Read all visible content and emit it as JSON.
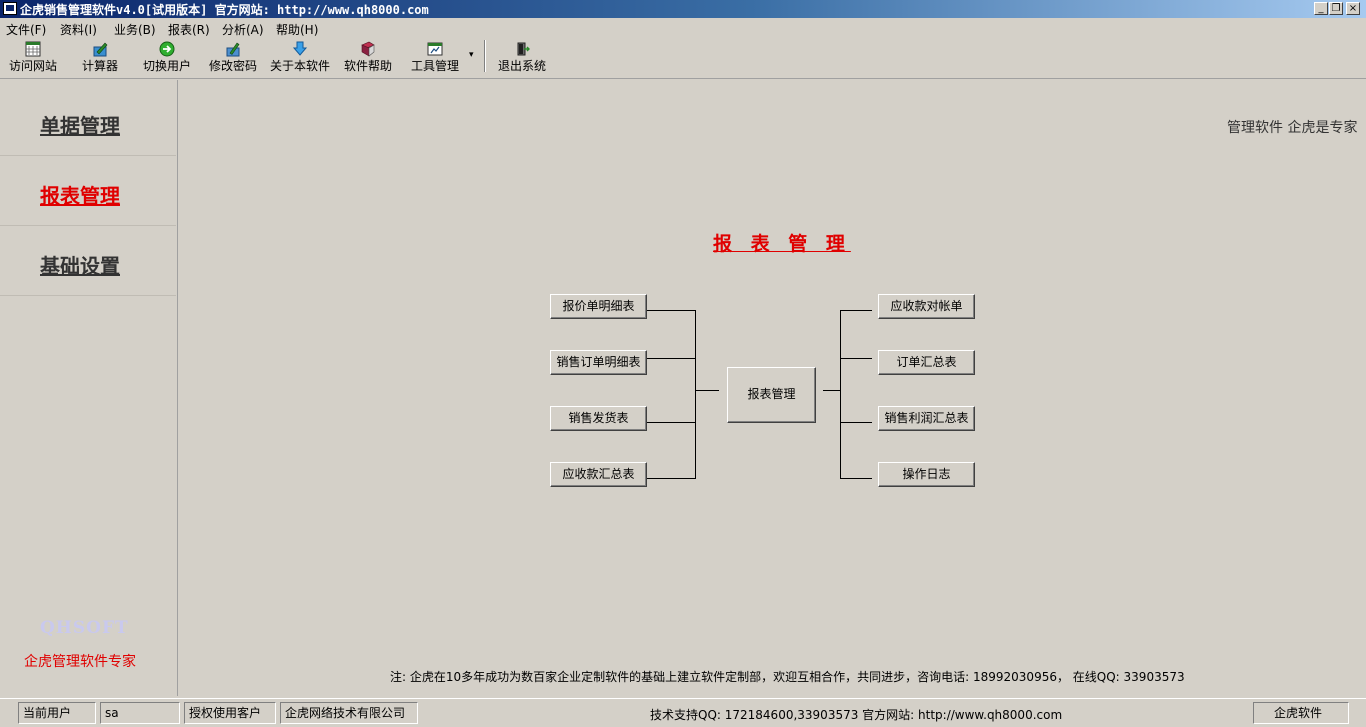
{
  "window": {
    "title": "企虎销售管理软件v4.0[试用版本] 官方网站: http://www.qh8000.com",
    "controls": [
      "_",
      "❐",
      "×"
    ]
  },
  "menu": [
    {
      "label": "文件(F)"
    },
    {
      "label": "资料(I)"
    },
    {
      "label": "业务(B)"
    },
    {
      "label": "报表(R)"
    },
    {
      "label": "分析(A)"
    },
    {
      "label": "帮助(H)"
    }
  ],
  "toolbar": [
    {
      "label": "访问网站",
      "icon": "calendar-grid-icon"
    },
    {
      "label": "计算器",
      "icon": "calculator-pen-icon"
    },
    {
      "label": "切换用户",
      "icon": "green-arrow-circle-icon"
    },
    {
      "label": "修改密码",
      "icon": "pen-chart-icon"
    },
    {
      "label": "关于本软件",
      "icon": "blue-down-arrow-icon"
    },
    {
      "label": "软件帮助",
      "icon": "help-book-icon"
    },
    {
      "label": "工具管理",
      "icon": "tool-window-icon",
      "dropdown": "▾"
    },
    {
      "label": "退出系统",
      "icon": "exit-door-icon"
    }
  ],
  "sidebar": {
    "items": [
      {
        "label": "单据管理",
        "active": false
      },
      {
        "label": "报表管理",
        "active": true
      },
      {
        "label": "基础设置",
        "active": false
      }
    ],
    "brand": "QHSOFT",
    "tagline": "企虎管理软件专家"
  },
  "main": {
    "slogan": "管理软件  企虎是专家",
    "title": "报 表 管 理",
    "center_button": "报表管理",
    "left_buttons": [
      "报价单明细表",
      "销售订单明细表",
      "销售发货表",
      "应收款汇总表"
    ],
    "right_buttons": [
      "应收款对帐单",
      "订单汇总表",
      "销售利润汇总表",
      "操作日志"
    ],
    "note": "注: 企虎在10多年成功为数百家企业定制软件的基础上建立软件定制部，欢迎互相合作，共同进步，咨询电话: 18992030956，  在线QQ: 33903573"
  },
  "status": {
    "current_user_label": "当前用户",
    "current_user": "sa",
    "licensed_label": "授权使用客户",
    "licensed_customer": "企虎网络技术有限公司",
    "support": "技术支持QQ: 172184600,33903573 官方网站: http://www.qh8000.com",
    "right": "企虎软件"
  },
  "colors": {
    "title_gradient_start": "#0a246a",
    "accent_red": "#e00000",
    "face": "#d4d0c8"
  }
}
